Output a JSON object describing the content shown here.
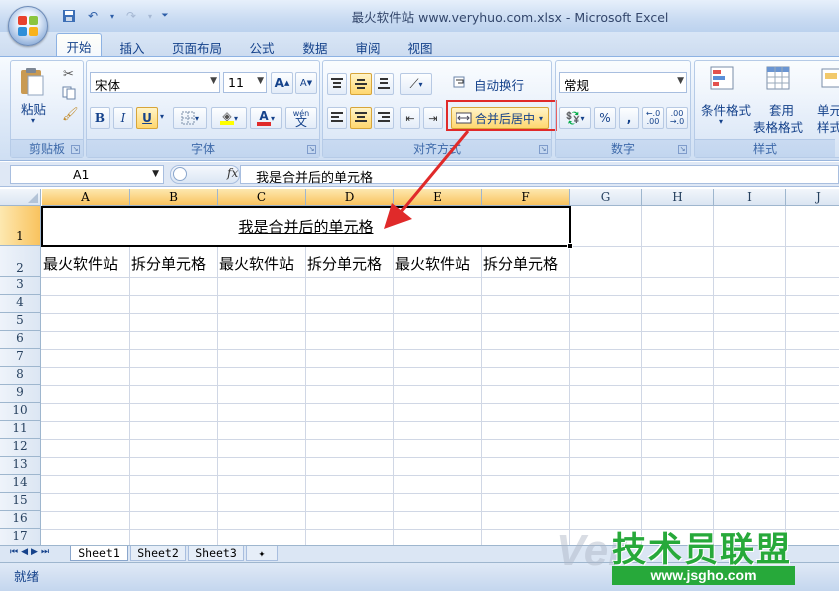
{
  "window": {
    "title": "最火软件站 www.veryhuo.com.xlsx - Microsoft Excel"
  },
  "tabs": [
    "开始",
    "插入",
    "页面布局",
    "公式",
    "数据",
    "审阅",
    "视图"
  ],
  "ribbon": {
    "clipboard": {
      "paste": "粘贴",
      "label": "剪贴板"
    },
    "font": {
      "name": "宋体",
      "size": "11",
      "bold": "B",
      "italic": "I",
      "underline": "U",
      "grow": "A",
      "shrink": "A",
      "color_letter": "A",
      "wen": "wén",
      "wen_char": "文",
      "label": "字体"
    },
    "alignment": {
      "wrap": "自动换行",
      "merge": "合并后居中",
      "label": "对齐方式"
    },
    "number": {
      "format": "常规",
      "percent": "%",
      "comma": ",",
      "inc": "+.0\n.00",
      "dec": ".00\n→.0",
      "label": "数字"
    },
    "styles": {
      "conditional": "条件格式",
      "table1": "套用",
      "table2": "表格格式",
      "cell1": "单元",
      "cell2": "样式",
      "label": "样式"
    }
  },
  "formula_bar": {
    "name_box": "A1",
    "fx": "fx",
    "value": "我是合并后的单元格"
  },
  "columns": [
    "A",
    "B",
    "C",
    "D",
    "E",
    "F",
    "G",
    "H",
    "I",
    "J"
  ],
  "rows": [
    "1",
    "2",
    "3",
    "4",
    "5",
    "6",
    "7",
    "8",
    "9",
    "10",
    "11",
    "12",
    "13",
    "14",
    "15",
    "16",
    "17"
  ],
  "cells": {
    "merged_A1": "我是合并后的单元格",
    "row2": [
      "最火软件站",
      "拆分单元格",
      "最火软件站",
      "拆分单元格",
      "最火软件站",
      "拆分单元格"
    ]
  },
  "sheets": [
    "Sheet1",
    "Sheet2",
    "Sheet3"
  ],
  "status": "就绪",
  "watermark": {
    "brand": "技术员联盟",
    "url": "www.jsgho.com",
    "faint": "Ver"
  },
  "colors": {
    "accent_red": "#e02a2a",
    "selected_header": "#f9c35f"
  }
}
